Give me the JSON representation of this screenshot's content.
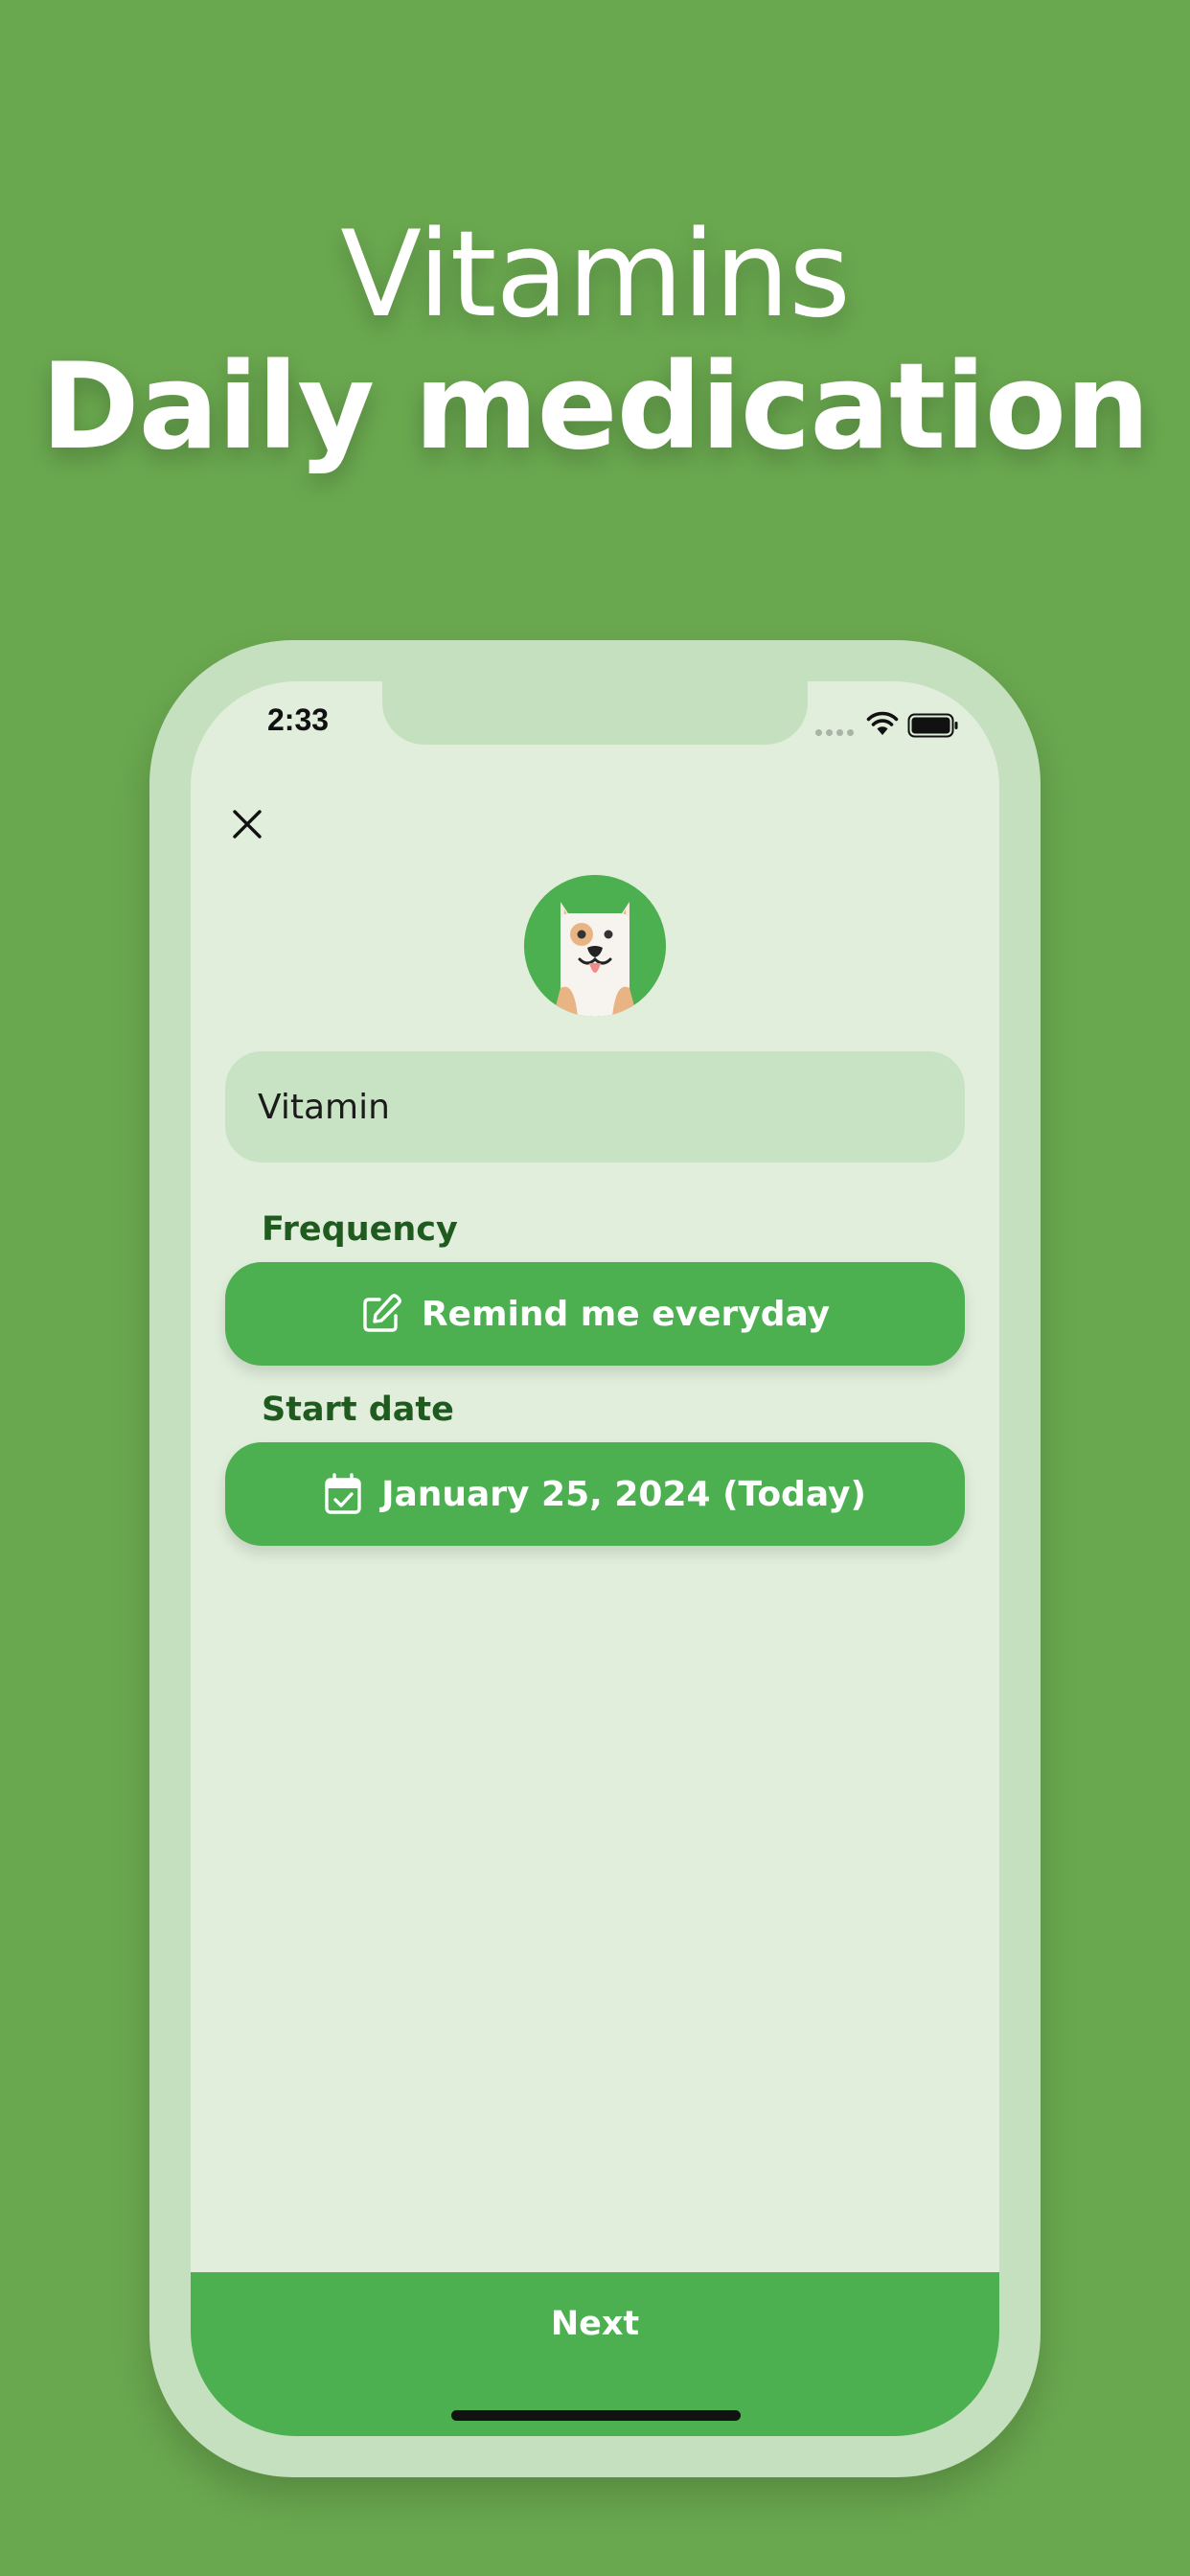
{
  "headline": {
    "line1": "Vitamins",
    "line2": "Daily medication"
  },
  "status_bar": {
    "time": "2:33",
    "wifi_icon": "wifi-icon",
    "battery_icon": "battery-icon"
  },
  "toolbar": {
    "close_icon": "close-icon"
  },
  "avatar": {
    "icon": "dog-face-icon",
    "background_color": "#4caf50"
  },
  "form": {
    "name_value": "Vitamin",
    "frequency_label": "Frequency",
    "frequency_button": "Remind me everyday",
    "frequency_icon": "edit-icon",
    "start_date_label": "Start date",
    "start_date_button": "January 25, 2024 (Today)",
    "start_date_icon": "calendar-check-icon"
  },
  "footer": {
    "next_label": "Next"
  },
  "colors": {
    "page_background": "#6aa84f",
    "accent": "#4caf50",
    "screen_background": "#e1eedc",
    "field_background": "#c8e3c4",
    "label_color": "#1f5a1f"
  }
}
